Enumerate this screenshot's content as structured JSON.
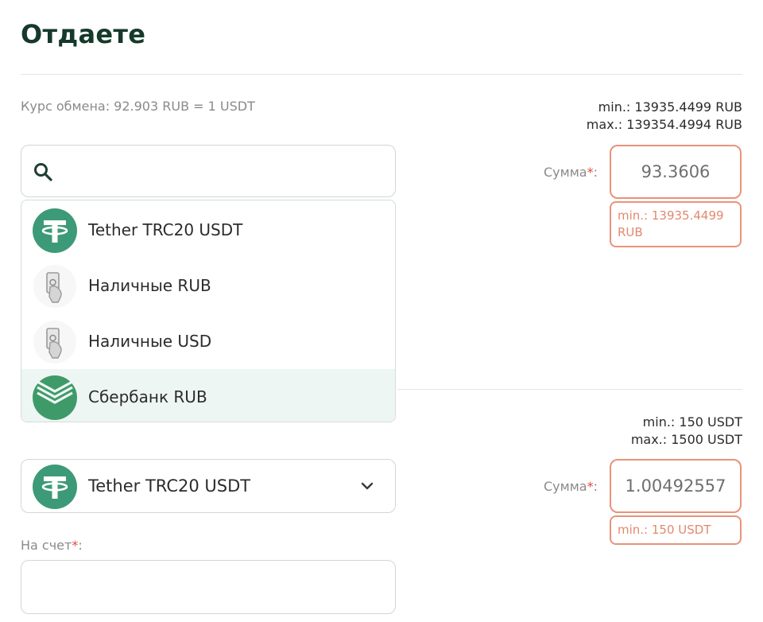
{
  "give": {
    "title": "Отдаете",
    "rate": "Курс обмена: 92.903 RUB = 1 USDT",
    "min": "min.: 13935.4499 RUB",
    "max": "max.: 139354.4994 RUB",
    "search": {
      "value": "",
      "placeholder": ""
    },
    "options": [
      {
        "label": "Tether TRC20 USDT",
        "icon": "tether-icon"
      },
      {
        "label": "Наличные RUB",
        "icon": "cash-icon"
      },
      {
        "label": "Наличные USD",
        "icon": "cash-icon"
      },
      {
        "label": "Сбербанк RUB",
        "icon": "sberbank-icon"
      }
    ],
    "sum_label": "Сумма",
    "sum_required_mark": "*",
    "sum_separator": ":",
    "sum_value": "93.3606",
    "sum_error": "min.: 13935.4499 RUB"
  },
  "receive": {
    "min": "min.: 150 USDT",
    "max": "max.: 1500 USDT",
    "selected_currency": "Tether TRC20 USDT",
    "selected_icon": "tether-icon",
    "sum_label": "Сумма",
    "sum_required_mark": "*",
    "sum_separator": ":",
    "sum_value": "1.00492557",
    "sum_error": "min.: 150 USDT",
    "account_label": "На счет",
    "account_required_mark": "*",
    "account_separator": ":",
    "account_value": ""
  },
  "colors": {
    "brand_dark": "#15392b",
    "tether_green": "#3d9a78",
    "sber_green": "#3f9a6a",
    "error": "#e8937a",
    "required": "#e14a3a",
    "highlight_bg": "#eef6f3"
  }
}
